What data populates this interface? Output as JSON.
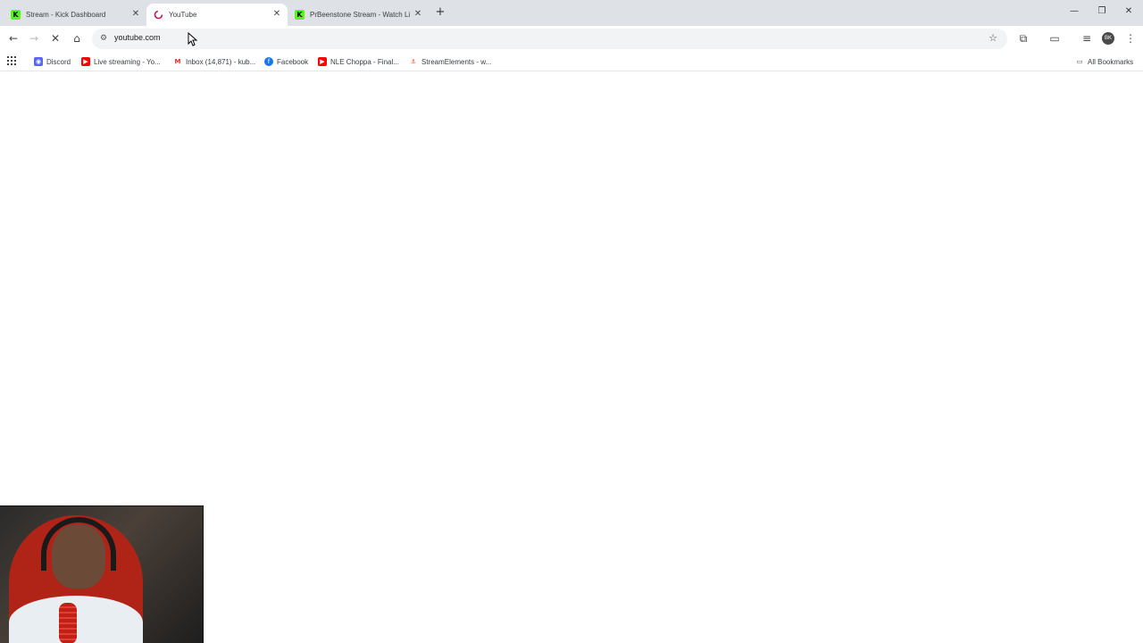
{
  "browser": {
    "tabs": [
      {
        "title": "Stream - Kick Dashboard",
        "favicon": "kick-icon",
        "active": false
      },
      {
        "title": "YouTube",
        "favicon": "youtube-icon",
        "active": true
      },
      {
        "title": "PrBeenstone Stream - Watch Li",
        "favicon": "kick-icon",
        "active": false
      }
    ],
    "new_tab": "+",
    "omnibox": {
      "url": "youtube.com"
    },
    "bookmarks": [
      {
        "label": "Discord",
        "icon": "discord-icon",
        "color": "#5865f2"
      },
      {
        "label": "Live streaming - Yo...",
        "icon": "youtube-icon",
        "color": "#ff0000"
      },
      {
        "label": "Inbox (14,871) - kub...",
        "icon": "gmail-icon",
        "color": "#d93025"
      },
      {
        "label": "Facebook",
        "icon": "facebook-icon",
        "color": "#1877f2"
      },
      {
        "label": "NLE Choppa - Final...",
        "icon": "youtube-icon",
        "color": "#ff0000"
      },
      {
        "label": "StreamElements - w...",
        "icon": "streamelements-icon",
        "color": "#e64a19"
      }
    ],
    "all_bookmarks": "All Bookmarks",
    "profile_initials": "BK"
  },
  "colors": {
    "tabstrip": "#dee1e6",
    "kick_green": "#53fc18",
    "youtube_red": "#ff0000"
  }
}
